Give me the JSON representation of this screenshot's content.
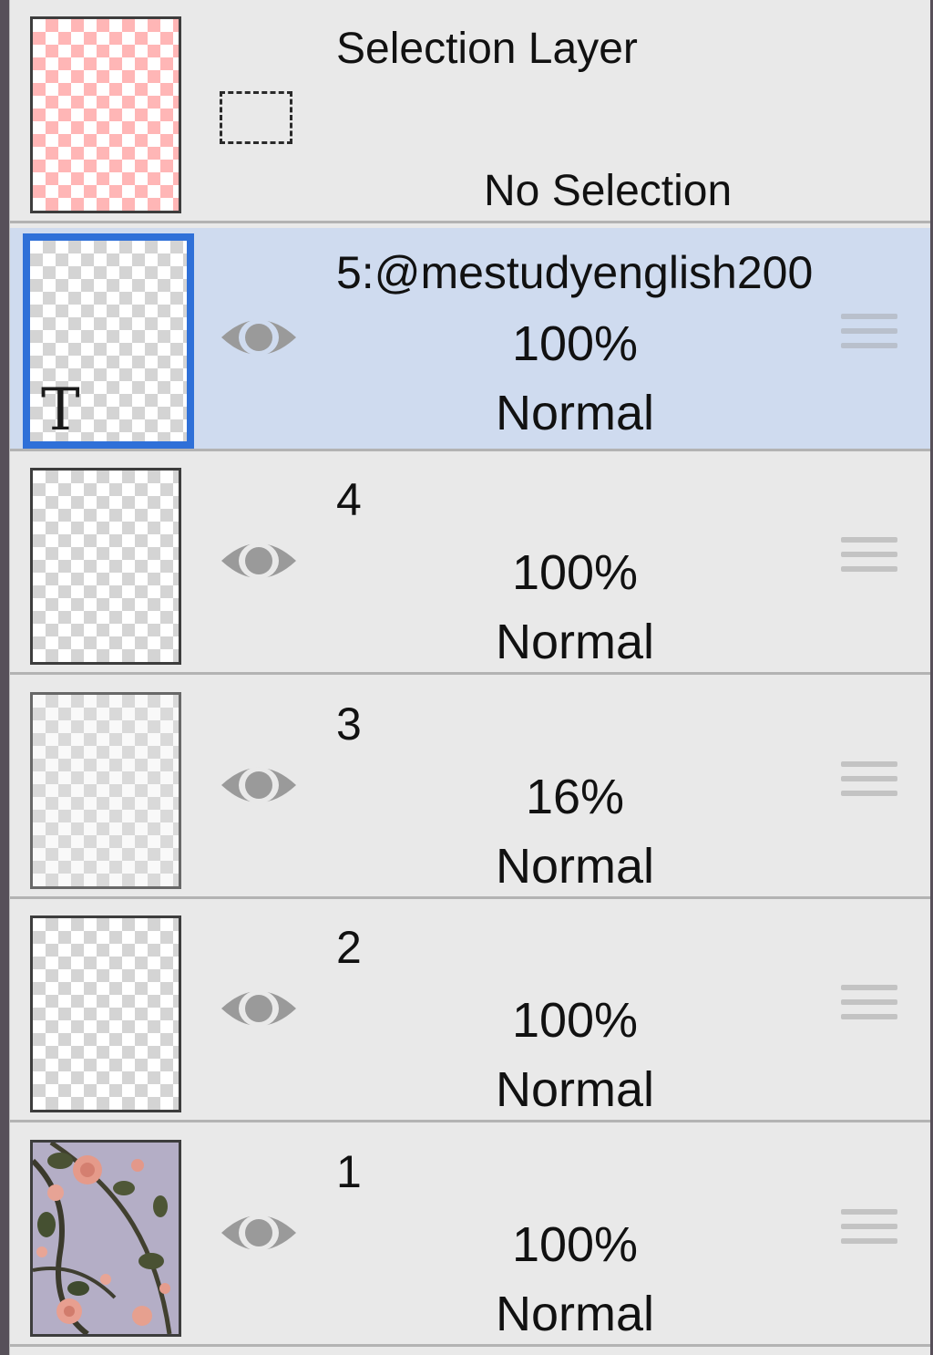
{
  "selection_layer": {
    "title": "Selection Layer",
    "status": "No Selection"
  },
  "layers": [
    {
      "name": "5:@mestudyenglish200",
      "opacity": "100%",
      "blend": "Normal",
      "selected": true,
      "thumb_glyph": "T",
      "visible": true
    },
    {
      "name": "4",
      "opacity": "100%",
      "blend": "Normal",
      "selected": false,
      "visible": true
    },
    {
      "name": "3",
      "opacity": "16%",
      "blend": "Normal",
      "selected": false,
      "visible": true
    },
    {
      "name": "2",
      "opacity": "100%",
      "blend": "Normal",
      "selected": false,
      "visible": true
    },
    {
      "name": "1",
      "opacity": "100%",
      "blend": "Normal",
      "selected": false,
      "visible": true
    }
  ],
  "icons": {
    "visibility": "eye-icon",
    "drag": "drag-handle-icon",
    "selection": "dashed-rectangle-icon",
    "text_layer": "text-layer-glyph"
  },
  "colors": {
    "selected_row": "#cfdbef",
    "active_thumb_border": "#2f70d8",
    "panel_bg": "#e9e9e9"
  }
}
